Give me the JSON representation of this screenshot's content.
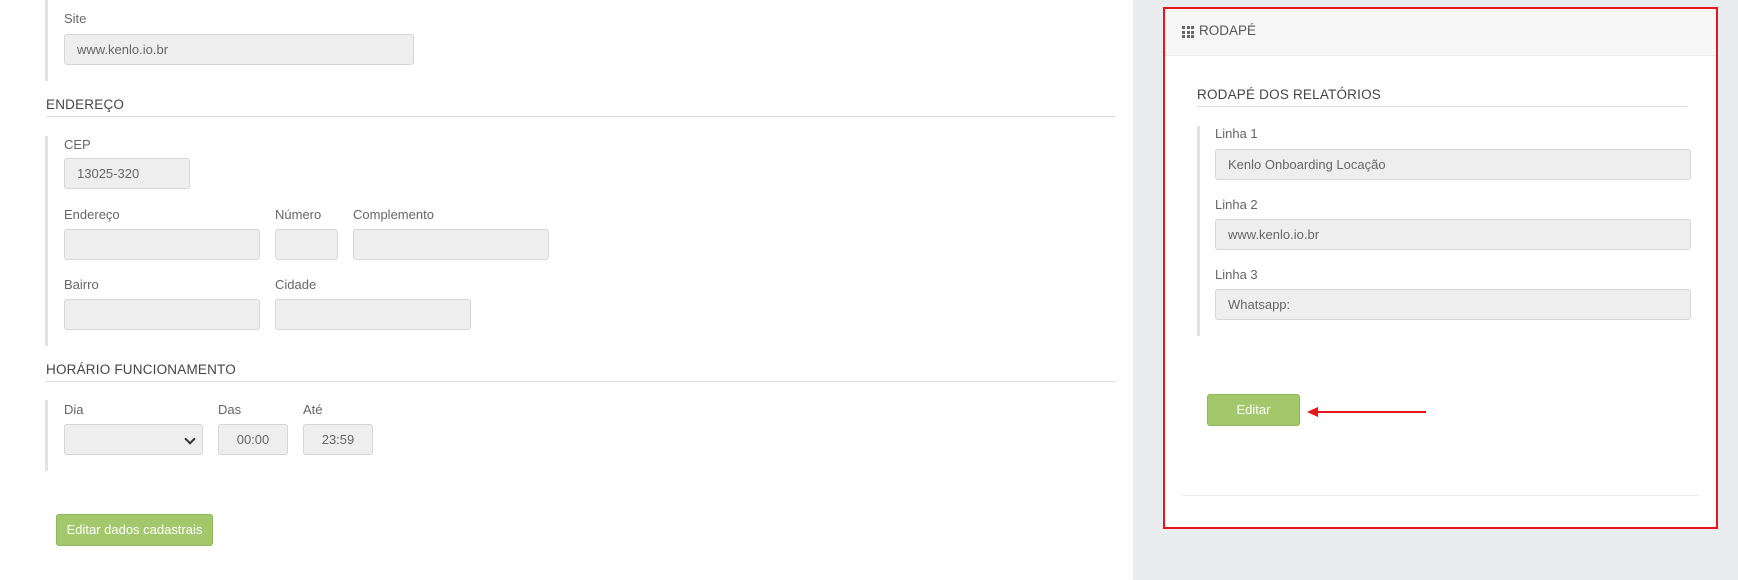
{
  "contact": {
    "site_label": "Site",
    "site_value": "www.kenlo.io.br"
  },
  "address": {
    "section_title": "ENDEREÇO",
    "cep_label": "CEP",
    "cep_value": "13025-320",
    "endereco_label": "Endereço",
    "endereco_value": "",
    "numero_label": "Número",
    "numero_value": "",
    "complemento_label": "Complemento",
    "complemento_value": "",
    "bairro_label": "Bairro",
    "bairro_value": "",
    "cidade_label": "Cidade",
    "cidade_value": ""
  },
  "hours": {
    "section_title": "HORÁRIO FUNCIONAMENTO",
    "dia_label": "Dia",
    "dia_value": "",
    "das_label": "Das",
    "das_value": "00:00",
    "ate_label": "Até",
    "ate_value": "23:59"
  },
  "left_actions": {
    "edit_label": "Editar dados cadastrais"
  },
  "footer_panel": {
    "title": "RODAPÉ",
    "subtitle": "RODAPÉ DOS RELATÓRIOS",
    "linha1_label": "Linha 1",
    "linha1_value": "Kenlo Onboarding  Locação",
    "linha2_label": "Linha 2",
    "linha2_value": "www.kenlo.io.br",
    "linha3_label": "Linha 3",
    "linha3_value": "Whatsapp:",
    "edit_label": "Editar"
  },
  "colors": {
    "accent_green": "#a3c86b",
    "highlight_red": "#e8161c",
    "input_bg": "#eeeeee"
  }
}
